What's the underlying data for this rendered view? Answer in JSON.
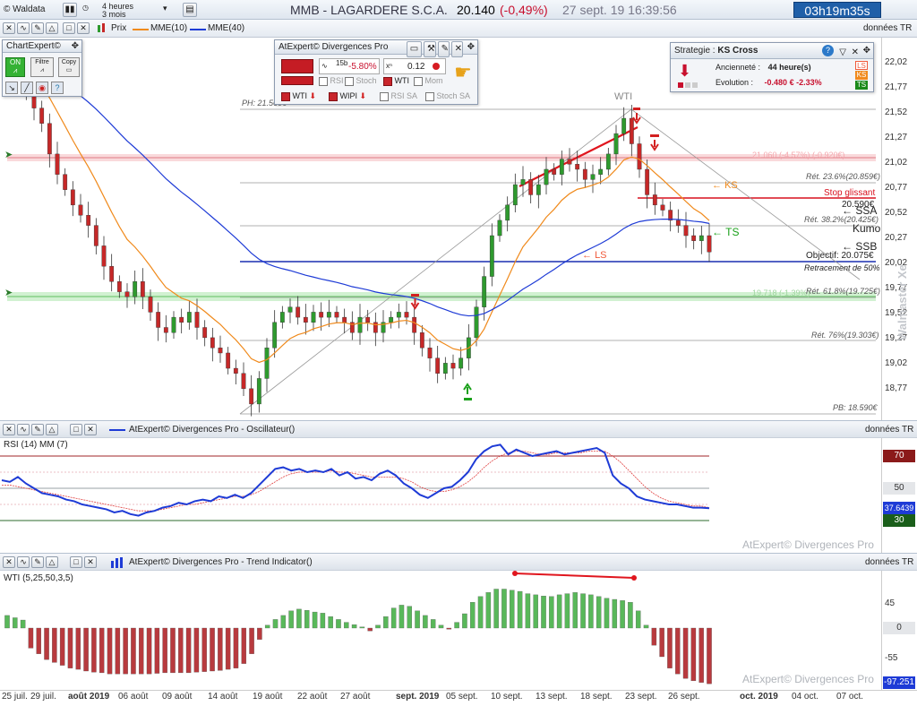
{
  "titlebar": {
    "app": "Waldata",
    "period_line1": "4 heures",
    "period_line2": "3 mois",
    "instrument": "MMB - LAGARDERE S.C.A.",
    "price": "20.140",
    "change": "(-0,49%)",
    "datetime": "27 sept. 19 16:39:56",
    "countdown": "03h19m35s"
  },
  "toolbar": {
    "prix_label": "Prix",
    "mme10": "MME(10)",
    "mme40": "MME(40)",
    "donnees": "données TR"
  },
  "chartexpert": {
    "title": "ChartExpert©",
    "on_label": "ON",
    "filtre_label": "Filtre",
    "copy_label": "Copy"
  },
  "divergences_panel": {
    "title": "AtExpert© Divergences Pro",
    "period_badge": "15b",
    "pct_value": "-5.80%",
    "value": "0.12",
    "chk_rsi": "RSI",
    "chk_stoch": "Stoch",
    "chk_wti": "WTI",
    "chk_mom": "Mom",
    "sig_wti": "WTI",
    "sig_wipi": "WIPI",
    "chk_rsisa": "RSI SA",
    "chk_stochsa": "Stoch SA"
  },
  "strategie_panel": {
    "label": "Strategie :",
    "name": "KS Cross",
    "anciennete_label": "Ancienneté :",
    "anciennete_value": "44 heure(s)",
    "evolution_label": "Evolution :",
    "evolution_value": "-0.480 € -2.33%",
    "tag_ls": "LS",
    "tag_ks": "KS",
    "tag_ts": "TS"
  },
  "price_axis": [
    "22,02",
    "21,77",
    "21,52",
    "21,27",
    "21,02",
    "20,77",
    "20,52",
    "20,27",
    "20,02",
    "19,77",
    "19,52",
    "19,27",
    "19,02",
    "18,77"
  ],
  "annotations": {
    "ph": "PH: 21.560€",
    "pb": "PB: 18.590€",
    "ret236": "Rét. 23.6%(20.859€)",
    "ret382": "Rét. 38.2%(20.425€)",
    "ret618": "Rét. 61.8%(19.725€)",
    "ret76": "Rét. 76%(19.303€)",
    "res_top": "21.060 (-4.57%) (-0.920€)",
    "res_mid": "19.718 (-1.39%)",
    "stop_glissant": "Stop glissant",
    "stop_value": "20.590€",
    "objectif": "Objectif: 20.075€",
    "retracement": "Retracement de 50%",
    "ssa": "SSA",
    "ssb": "SSB",
    "kumo": "Kumo",
    "ks": "KS",
    "ts": "TS",
    "ls": "LS",
    "wti": "WTI"
  },
  "rsi_pane": {
    "title": "AtExpert© Divergences Pro - Oscillateur()",
    "label": "RSI (14) MM (7)",
    "level70": "70",
    "level50": "50",
    "level30": "30",
    "current": "37.6439",
    "donnees": "données TR",
    "watermark": "AtExpert© Divergences Pro"
  },
  "trend_pane": {
    "title": "AtExpert© Divergences Pro - Trend Indicator()",
    "label": "WTI (5,25,50,3,5)",
    "level45": "45",
    "level0": "0",
    "level_m55": "-55",
    "current": "-97.251",
    "donnees": "données TR",
    "watermark": "AtExpert© Divergences Pro"
  },
  "vertical_watermark": "Walmaster Xe",
  "x_axis": [
    {
      "label": "25 juil.",
      "bold": false
    },
    {
      "label": "29 juil.",
      "bold": false
    },
    {
      "label": "août 2019",
      "bold": true
    },
    {
      "label": "06 août",
      "bold": false
    },
    {
      "label": "09 août",
      "bold": false
    },
    {
      "label": "14 août",
      "bold": false
    },
    {
      "label": "19 août",
      "bold": false
    },
    {
      "label": "22 août",
      "bold": false
    },
    {
      "label": "27 août",
      "bold": false
    },
    {
      "label": "sept. 2019",
      "bold": true
    },
    {
      "label": "05 sept.",
      "bold": false
    },
    {
      "label": "10 sept.",
      "bold": false
    },
    {
      "label": "13 sept.",
      "bold": false
    },
    {
      "label": "18 sept.",
      "bold": false
    },
    {
      "label": "23 sept.",
      "bold": false
    },
    {
      "label": "26 sept.",
      "bold": false
    },
    {
      "label": "oct. 2019",
      "bold": true
    },
    {
      "label": "04 oct.",
      "bold": false
    },
    {
      "label": "07 oct.",
      "bold": false
    }
  ],
  "chart_data": {
    "type": "candlestick",
    "close_series": [
      22.0,
      21.85,
      21.7,
      21.55,
      21.4,
      21.1,
      20.9,
      20.75,
      20.6,
      20.5,
      20.4,
      20.2,
      20.0,
      19.85,
      19.75,
      19.7,
      19.85,
      19.7,
      19.55,
      19.4,
      19.35,
      19.5,
      19.45,
      19.55,
      19.4,
      19.3,
      19.2,
      19.15,
      19.0,
      18.95,
      18.8,
      18.65,
      18.9,
      19.2,
      19.45,
      19.55,
      19.6,
      19.5,
      19.45,
      19.55,
      19.5,
      19.55,
      19.5,
      19.45,
      19.35,
      19.5,
      19.45,
      19.35,
      19.45,
      19.5,
      19.55,
      19.5,
      19.35,
      19.2,
      19.1,
      18.95,
      19.05,
      19.0,
      19.1,
      19.3,
      19.6,
      19.9,
      20.3,
      20.45,
      20.6,
      20.8,
      20.85,
      20.7,
      20.8,
      20.95,
      20.9,
      21.05,
      21.0,
      20.95,
      20.85,
      20.9,
      20.95,
      21.1,
      21.3,
      21.45,
      21.2,
      20.95,
      20.7,
      20.6,
      20.55,
      20.45,
      20.4,
      20.3,
      20.25,
      20.3,
      20.14
    ],
    "rsi_series": [
      55,
      54,
      57,
      53,
      50,
      47,
      46,
      45,
      43,
      42,
      40,
      39,
      38,
      37,
      35,
      36,
      34,
      33,
      35,
      36,
      38,
      39,
      41,
      40,
      42,
      43,
      42,
      45,
      44,
      46,
      44,
      47,
      52,
      57,
      62,
      63,
      61,
      62,
      60,
      61,
      60,
      62,
      58,
      60,
      56,
      57,
      55,
      59,
      61,
      58,
      53,
      50,
      46,
      44,
      47,
      50,
      51,
      55,
      60,
      68,
      73,
      76,
      77,
      71,
      74,
      72,
      70,
      71,
      72,
      73,
      71,
      72,
      73,
      74,
      75,
      72,
      58,
      53,
      50,
      45,
      43,
      42,
      41,
      40,
      40,
      39,
      38,
      38,
      37.64
    ],
    "rsi_ma_series": [
      52,
      52,
      51,
      50,
      49,
      48,
      47,
      46,
      45,
      44,
      43,
      42,
      41,
      40,
      39,
      38,
      37,
      36,
      36,
      36,
      37,
      38,
      39,
      40,
      40,
      41,
      42,
      43,
      44,
      45,
      45,
      46,
      48,
      51,
      54,
      57,
      59,
      60,
      60,
      60,
      60,
      61,
      60,
      60,
      59,
      58,
      57,
      57,
      57,
      57,
      56,
      54,
      51,
      49,
      48,
      48,
      49,
      51,
      54,
      58,
      63,
      67,
      70,
      72,
      73,
      73,
      72,
      71,
      71,
      72,
      72,
      72,
      72,
      73,
      73,
      73,
      70,
      66,
      61,
      56,
      51,
      47,
      44,
      42,
      41,
      40,
      39,
      39,
      38
    ],
    "wti_series": [
      22,
      18,
      14,
      -35,
      -45,
      -55,
      -60,
      -65,
      -70,
      -72,
      -75,
      -77,
      -78,
      -80,
      -80,
      -80,
      -80,
      -80,
      -80,
      -79,
      -78,
      -78,
      -78,
      -78,
      -77,
      -76,
      -75,
      -74,
      -72,
      -70,
      -62,
      -45,
      -20,
      5,
      15,
      22,
      30,
      33,
      31,
      28,
      26,
      20,
      15,
      10,
      6,
      2,
      -5,
      5,
      20,
      35,
      40,
      38,
      30,
      22,
      15,
      5,
      -2,
      10,
      25,
      45,
      55,
      62,
      68,
      68,
      66,
      64,
      60,
      58,
      56,
      55,
      58,
      60,
      62,
      60,
      58,
      55,
      52,
      50,
      48,
      45,
      30,
      5,
      -30,
      -50,
      -70,
      -80,
      -88,
      -92,
      -95,
      -97.251
    ]
  }
}
